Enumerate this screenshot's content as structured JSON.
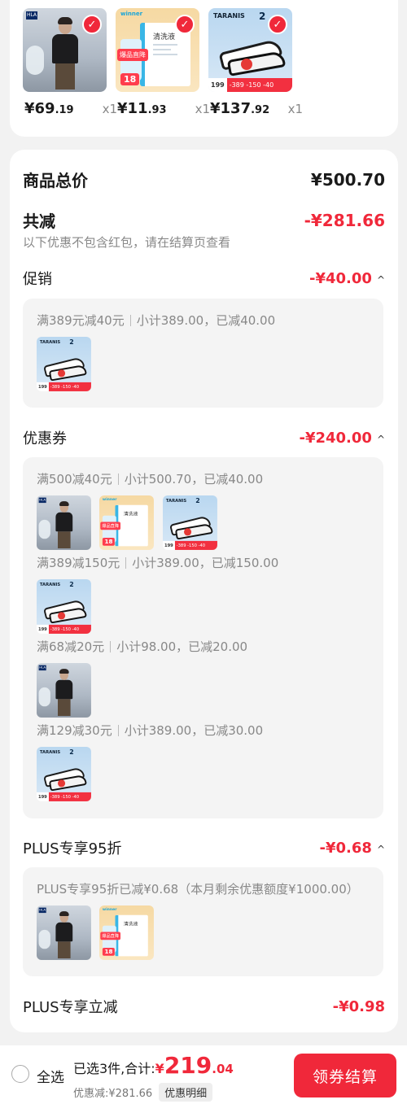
{
  "products": [
    {
      "price_int": "¥69",
      "price_dec": ".19",
      "qty": "x1",
      "kind": "t-shirt"
    },
    {
      "price_int": "¥11",
      "price_dec": ".93",
      "qty": "x1",
      "kind": "cleaner"
    },
    {
      "price_int": "¥137",
      "price_dec": ".92",
      "qty": "x1",
      "kind": "shoes"
    }
  ],
  "thumb_text": {
    "shirt_brand": "HLA",
    "clean_logo": "winner",
    "clean_title": "清洗液",
    "clean_tag": "爆品直降",
    "clean_tag2": "18",
    "shoe_brand": "TARANIS",
    "shoe_num": "2",
    "shoe_price": "199",
    "shoe_bar": "-389 -150 -40"
  },
  "summary": {
    "total_label": "商品总价",
    "total_value": "¥500.70",
    "reduce_label": "共减",
    "reduce_value": "-¥281.66",
    "note": "以下优惠不包含红包，请在结算页查看"
  },
  "sections": {
    "promo": {
      "label": "促销",
      "value": "-¥40.00",
      "caret": "^"
    },
    "coupon": {
      "label": "优惠券",
      "value": "-¥240.00",
      "caret": "^"
    },
    "plus95": {
      "label": "PLUS专享95折",
      "value": "-¥0.68",
      "caret": "^"
    },
    "plusdirect": {
      "label": "PLUS专享立减",
      "value": "-¥0.98"
    }
  },
  "rules": {
    "promo_1": {
      "a": "满389元减40元",
      "b": "小计389.00，已减40.00"
    },
    "coupon_1": {
      "a": "满500减40元",
      "b": "小计500.70，已减40.00"
    },
    "coupon_2": {
      "a": "满389减150元",
      "b": "小计389.00，已减150.00"
    },
    "coupon_3": {
      "a": "满68减20元",
      "b": "小计98.00，已减20.00"
    },
    "coupon_4": {
      "a": "满129减30元",
      "b": "小计389.00，已减30.00"
    },
    "plus_1": "PLUS专享95折已减¥0.68（本月剩余优惠额度¥1000.00）"
  },
  "bottom": {
    "select_all": "全选",
    "selected": "已选3件,合计:",
    "yen": "¥",
    "total_int": "219",
    "total_dec": ".04",
    "discount": "优惠减:¥281.66",
    "detail": "优惠明细",
    "checkout": "领券结算"
  },
  "colors": {
    "accent": "#f0283a",
    "background": "#f2f2f2"
  }
}
